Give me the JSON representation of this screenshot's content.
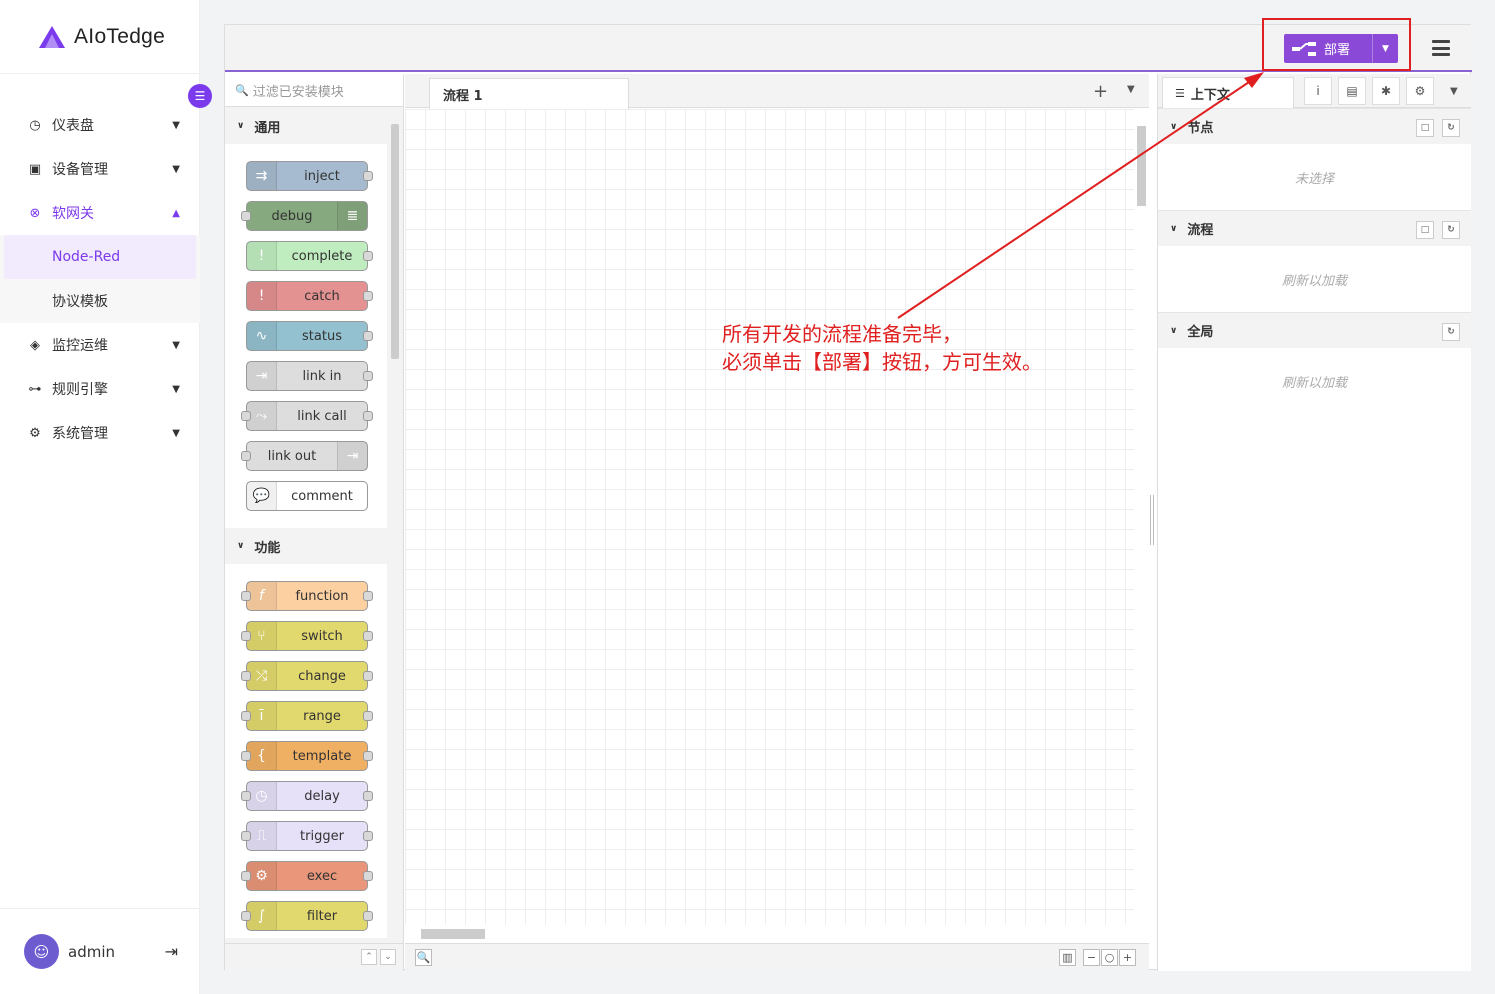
{
  "brand": {
    "name": "AIoTedge"
  },
  "sidebar": {
    "items": [
      {
        "label": "仪表盘",
        "icon": "dashboard-icon"
      },
      {
        "label": "设备管理",
        "icon": "device-icon"
      },
      {
        "label": "软网关",
        "icon": "gateway-icon",
        "active": true,
        "children": [
          {
            "label": "Node-Red",
            "selected": true
          },
          {
            "label": "协议模板"
          }
        ]
      },
      {
        "label": "监控运维",
        "icon": "monitor-icon"
      },
      {
        "label": "规则引擎",
        "icon": "rules-icon"
      },
      {
        "label": "系统管理",
        "icon": "settings-icon"
      }
    ]
  },
  "user": {
    "name": "admin"
  },
  "header": {
    "deploy_label": "部署"
  },
  "palette": {
    "filter_placeholder": "过滤已安装模块",
    "categories": [
      {
        "label": "通用",
        "nodes": [
          {
            "label": "inject",
            "color": "#a6bbcf"
          },
          {
            "label": "debug",
            "color": "#87a980"
          },
          {
            "label": "complete",
            "color": "#c0edc0"
          },
          {
            "label": "catch",
            "color": "#e49191"
          },
          {
            "label": "status",
            "color": "#94c1d0"
          },
          {
            "label": "link in",
            "color": "#dddddd"
          },
          {
            "label": "link call",
            "color": "#dddddd"
          },
          {
            "label": "link out",
            "color": "#dddddd"
          },
          {
            "label": "comment",
            "color": "#ffffff"
          }
        ]
      },
      {
        "label": "功能",
        "nodes": [
          {
            "label": "function",
            "color": "#fdd0a2"
          },
          {
            "label": "switch",
            "color": "#e2d96e"
          },
          {
            "label": "change",
            "color": "#e2d96e"
          },
          {
            "label": "range",
            "color": "#e2d96e"
          },
          {
            "label": "template",
            "color": "#f0b064"
          },
          {
            "label": "delay",
            "color": "#e6e0f8"
          },
          {
            "label": "trigger",
            "color": "#e6e0f8"
          },
          {
            "label": "exec",
            "color": "#e9967a"
          },
          {
            "label": "filter",
            "color": "#e2d96e"
          }
        ]
      }
    ]
  },
  "workspace": {
    "tab_label": "流程 1"
  },
  "annotation": {
    "line1": "所有开发的流程准备完毕，",
    "line2": "必须单击【部署】按钮，方可生效。"
  },
  "right_sidebar": {
    "tab_label": "上下文",
    "sections": [
      {
        "label": "节点",
        "body": "未选择"
      },
      {
        "label": "流程",
        "body": "刷新以加载"
      },
      {
        "label": "全局",
        "body": "刷新以加载"
      }
    ]
  },
  "colors": {
    "accent": "#7c3aed",
    "deploy": "#8a49d6",
    "annotation": "#e02020"
  }
}
